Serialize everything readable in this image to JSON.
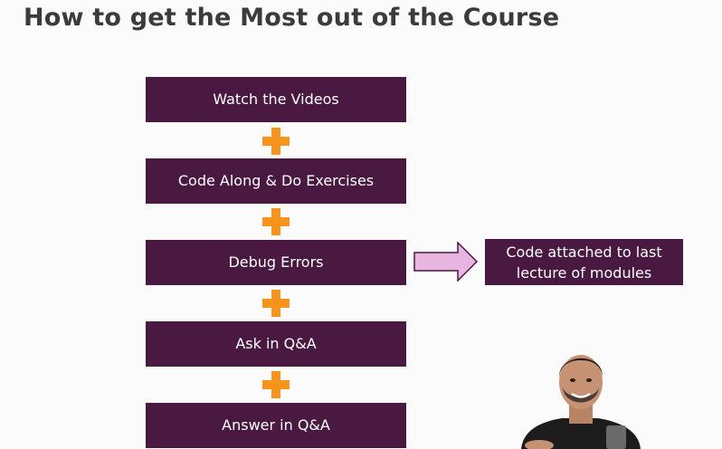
{
  "slide": {
    "title": "How to get the Most out of the Course",
    "steps": [
      "Watch the Videos",
      "Code Along & Do Exercises",
      "Debug Errors",
      "Ask in Q&A",
      "Answer in Q&A"
    ],
    "note": "Code attached to last lecture of modules",
    "icons": [
      "plus-icon",
      "right-arrow-icon"
    ],
    "colors": {
      "box": "#4a1942",
      "plus": "#f7941d",
      "arrow_fill": "#e8b4e0",
      "arrow_stroke": "#4a1942",
      "title": "#3b3b3b",
      "background": "#fbfbfb"
    }
  }
}
